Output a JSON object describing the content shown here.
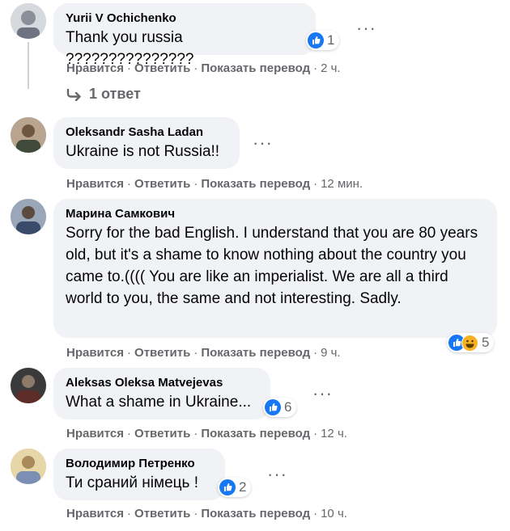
{
  "comments": [
    {
      "author": "Yurii V Ochichenko",
      "text": "Thank you russia ???????????????",
      "reactions": {
        "types": [
          "like"
        ],
        "count": "1"
      },
      "actions": {
        "like": "Нравится",
        "reply": "Ответить",
        "translate": "Показать перевод",
        "time": "2 ч."
      },
      "replies_label": "1 ответ"
    },
    {
      "author": "Oleksandr Sasha Ladan",
      "text": "Ukraine is not Russia!!",
      "actions": {
        "like": "Нравится",
        "reply": "Ответить",
        "translate": "Показать перевод",
        "time": "12 мин."
      }
    },
    {
      "author": "Марина Самкович",
      "text": "Sorry for the bad English. I understand that you are 80 years old, but it's a shame to know nothing about the country you came to.(((( You are like an imperialist. We are all a third world to you, the same and not interesting. Sadly.",
      "reactions": {
        "types": [
          "like",
          "haha"
        ],
        "count": "5"
      },
      "actions": {
        "like": "Нравится",
        "reply": "Ответить",
        "translate": "Показать перевод",
        "time": "9 ч."
      }
    },
    {
      "author": "Aleksas Oleksa Matvejevas",
      "text": "What a shame in Ukraine...",
      "reactions": {
        "types": [
          "like"
        ],
        "count": "6"
      },
      "actions": {
        "like": "Нравится",
        "reply": "Ответить",
        "translate": "Показать перевод",
        "time": "12 ч."
      }
    },
    {
      "author": "Володимир Петренко",
      "text": "Ти сраний німець !",
      "reactions": {
        "types": [
          "like"
        ],
        "count": "2"
      },
      "actions": {
        "like": "Нравится",
        "reply": "Ответить",
        "translate": "Показать перевод",
        "time": "10 ч."
      }
    }
  ],
  "colors": {
    "bubble": "#f0f2f5",
    "meta_text": "#65676b",
    "like_blue": "#1877f2",
    "haha_yellow": "#f7b125"
  }
}
